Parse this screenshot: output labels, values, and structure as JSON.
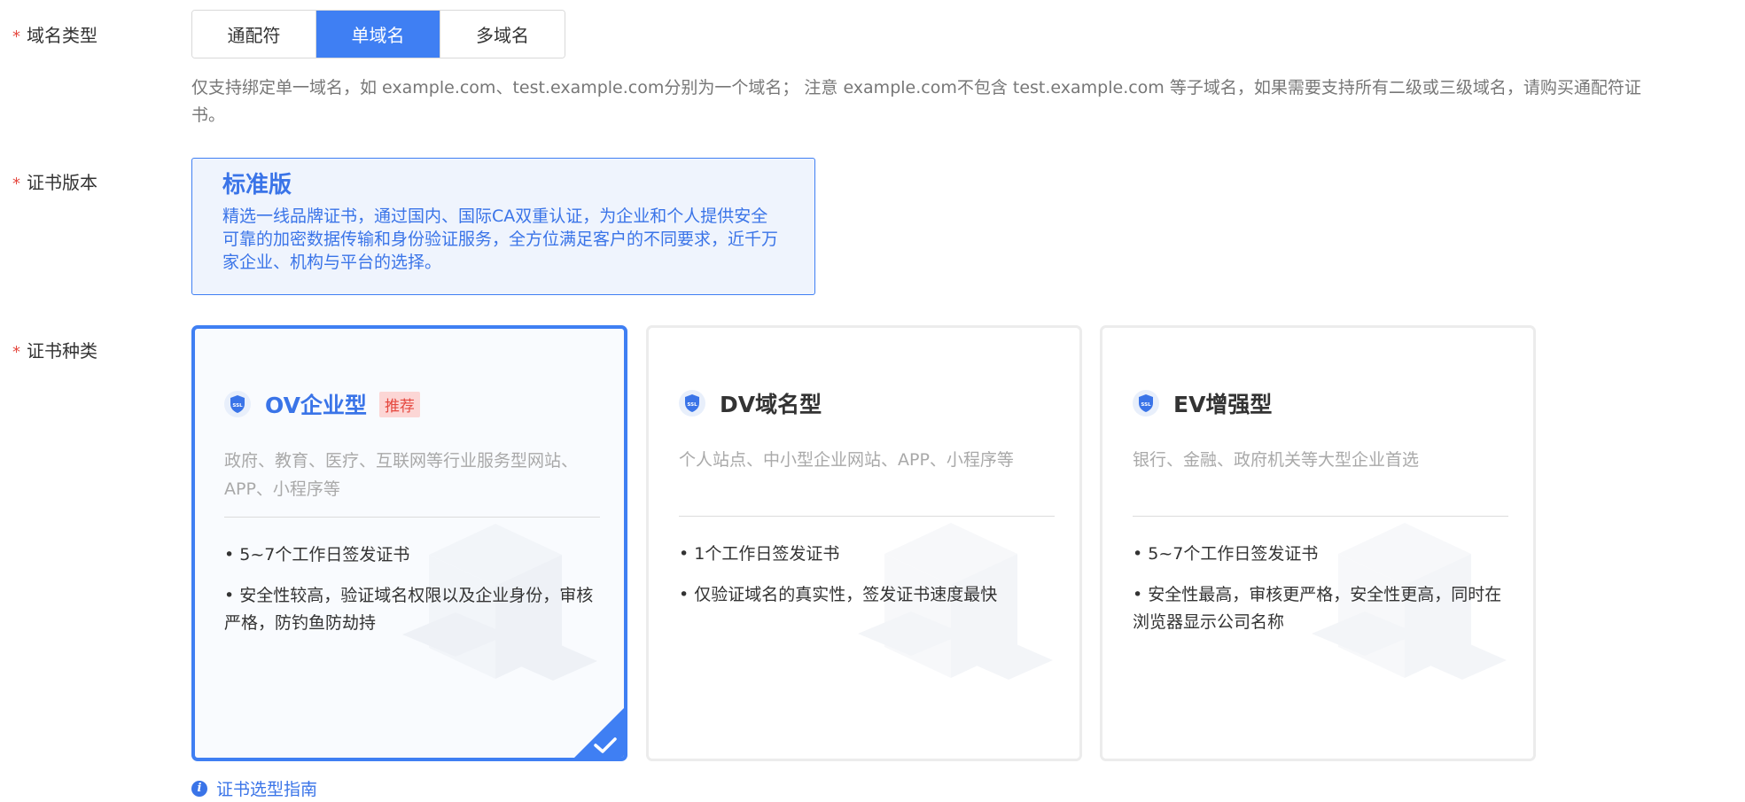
{
  "domain_type": {
    "label": "域名类型",
    "options": [
      "通配符",
      "单域名",
      "多域名"
    ],
    "selected": "单域名",
    "hint": "仅支持绑定单一域名，如 example.com、test.example.com分别为一个域名； 注意 example.com不包含 test.example.com 等子域名，如果需要支持所有二级或三级域名，请购买通配符证书。"
  },
  "cert_version": {
    "label": "证书版本",
    "title": "标准版",
    "desc": "精选一线品牌证书，通过国内、国际CA双重认证，为企业和个人提供安全可靠的加密数据传输和身份验证服务，全方位满足客户的不同要求，近千万家企业、机构与平台的选择。"
  },
  "cert_type": {
    "label": "证书种类",
    "cards": [
      {
        "title": "OV企业型",
        "badge": "推荐",
        "subtitle": "政府、教育、医疗、互联网等行业服务型网站、APP、小程序等",
        "features": [
          "• 5~7个工作日签发证书",
          "• 安全性较高，验证域名权限以及企业身份，审核严格，防钓鱼防劫持"
        ],
        "selected": true,
        "icon": "ssl-shield-icon"
      },
      {
        "title": "DV域名型",
        "badge": "",
        "subtitle": "个人站点、中小型企业网站、APP、小程序等",
        "features": [
          "• 1个工作日签发证书",
          "• 仅验证域名的真实性，签发证书速度最快"
        ],
        "selected": false,
        "icon": "ssl-shield-icon"
      },
      {
        "title": "EV增强型",
        "badge": "",
        "subtitle": "银行、金融、政府机关等大型企业首选",
        "features": [
          "• 5~7个工作日签发证书",
          "• 安全性最高，审核更严格，安全性更高，同时在浏览器显示公司名称"
        ],
        "selected": false,
        "icon": "ssl-shield-icon"
      }
    ],
    "guide_link": "证书选型指南"
  },
  "colors": {
    "accent": "#3f7ff3",
    "required": "#e5483f",
    "badge_bg": "#fcd6d5"
  }
}
